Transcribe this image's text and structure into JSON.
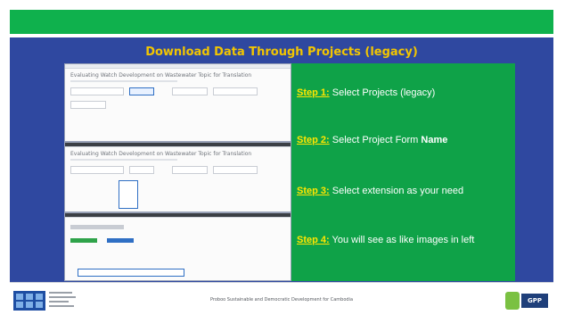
{
  "slide": {
    "title": "Download Data Through Projects (legacy)"
  },
  "screenshots": {
    "form_title": "Evaluating Watch Development on Wastewater Topic for Translation"
  },
  "steps": [
    {
      "label": "Step 1:",
      "text": " Select Projects (legacy)"
    },
    {
      "label": "Step 2:",
      "text": " Select Project Form ",
      "bold": "Name"
    },
    {
      "label": "Step 3:",
      "text": " Select extension as your need"
    },
    {
      "label": "Step 4:",
      "text": "  You will see as like images in left"
    }
  ],
  "footer": {
    "text": "Proboo Sustainable and Democratic Development for Cambodia",
    "logo_right_text": "GPP"
  },
  "colors": {
    "top_bar": "#0fb14d",
    "panel": "#2f48a0",
    "title": "#f3c600",
    "step_panel": "#0fa248",
    "step_label": "#ffe600"
  }
}
